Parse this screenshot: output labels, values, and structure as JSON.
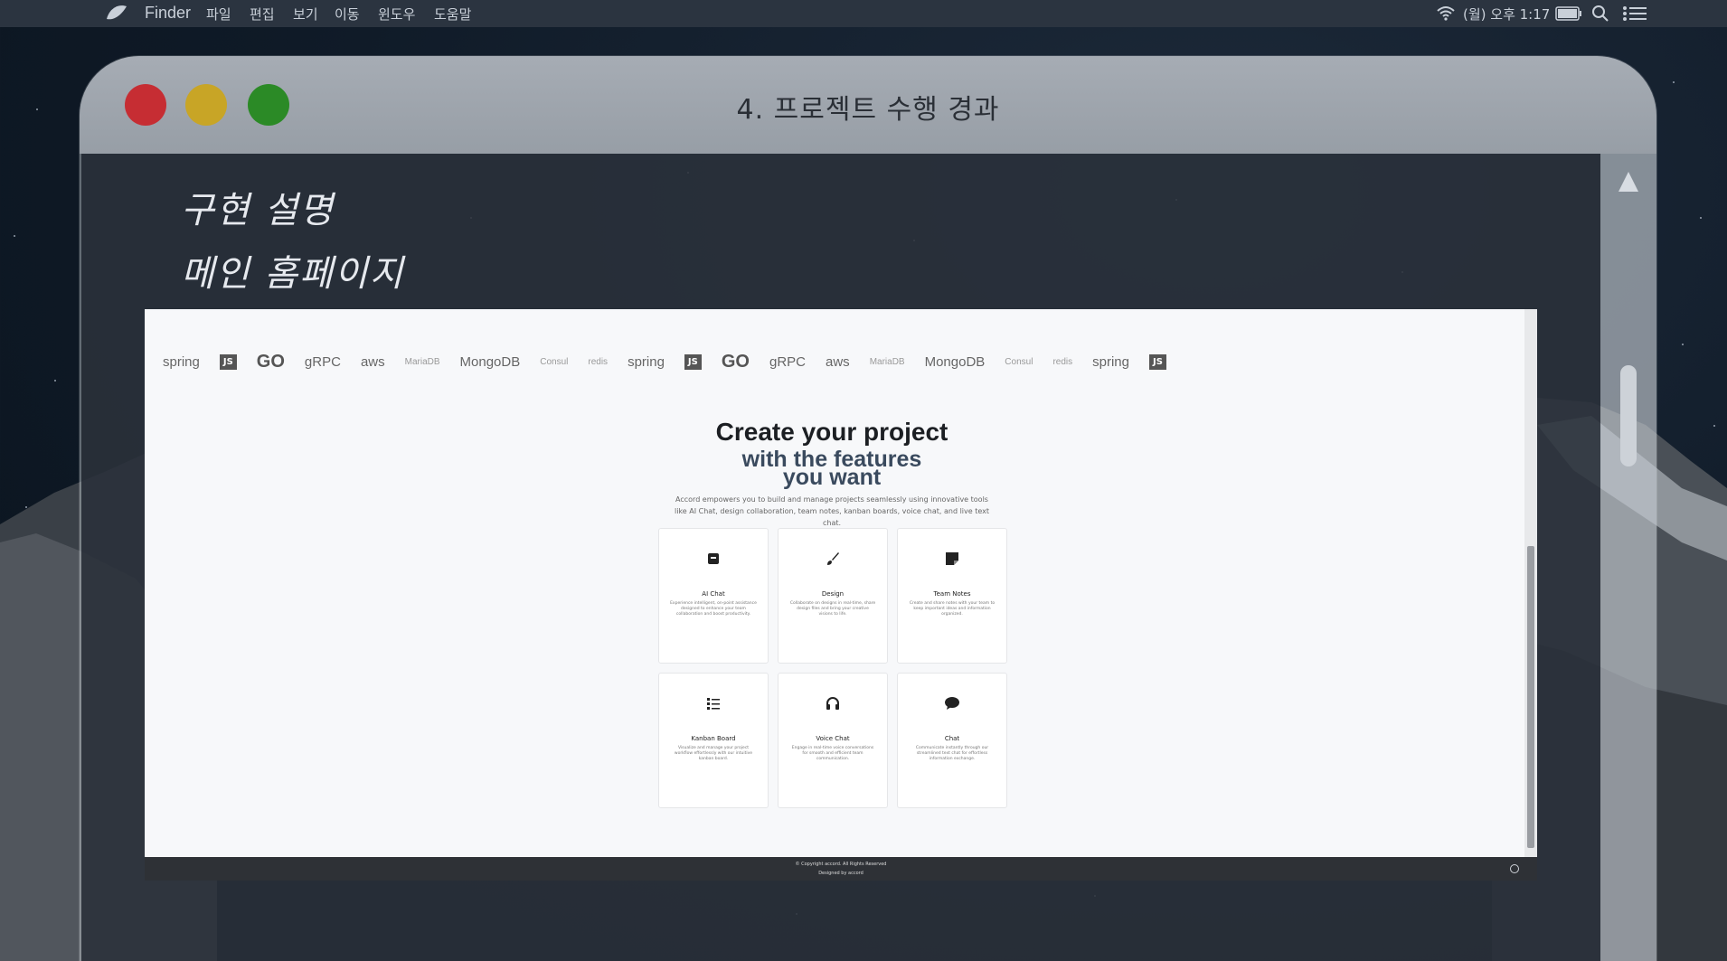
{
  "menubar": {
    "app_name": "Finder",
    "items": [
      "파일",
      "편집",
      "보기",
      "이동",
      "윈도우",
      "도움말"
    ],
    "clock": "(월) 오후 1:17"
  },
  "window": {
    "title": "4. 프로젝트 수행 경과"
  },
  "slide": {
    "heading_line1": "구현 설명",
    "heading_line2": "메인 홈페이지"
  },
  "site": {
    "logos": [
      "spring",
      "JS",
      "GO",
      "gRPC",
      "aws",
      "MariaDB",
      "MongoDB",
      "Consul",
      "redis",
      "spring",
      "JS",
      "GO",
      "gRPC",
      "aws",
      "MariaDB",
      "MongoDB",
      "Consul",
      "redis",
      "spring",
      "JS"
    ],
    "hero": {
      "title_line1": "Create your project",
      "title_line2": "with the features",
      "title_line3": "you want",
      "description": "Accord empowers you to build and manage projects seamlessly using innovative tools like AI Chat, design collaboration, team notes, kanban boards, voice chat, and live text chat."
    },
    "features": [
      {
        "title": "AI Chat",
        "icon": "robot-icon",
        "desc": "Experience intelligent, on-point assistance designed to enhance your team collaboration and boost productivity."
      },
      {
        "title": "Design",
        "icon": "paintbrush-icon",
        "desc": "Collaborate on designs in real-time, share design files and bring your creative visions to life."
      },
      {
        "title": "Team Notes",
        "icon": "note-icon",
        "desc": "Create and share notes with your team to keep important ideas and information organized."
      },
      {
        "title": "Kanban Board",
        "icon": "list-check-icon",
        "desc": "Visualize and manage your project workflow effortlessly with our intuitive kanban board."
      },
      {
        "title": "Voice Chat",
        "icon": "headphones-icon",
        "desc": "Engage in real-time voice conversations for smooth and efficient team communication."
      },
      {
        "title": "Chat",
        "icon": "chat-bubble-icon",
        "desc": "Communicate instantly through our streamlined text chat for effortless information exchange."
      }
    ],
    "footer": {
      "copyright": "© Copyright accord. All Rights Reserved",
      "designed": "Designed by accord"
    }
  }
}
